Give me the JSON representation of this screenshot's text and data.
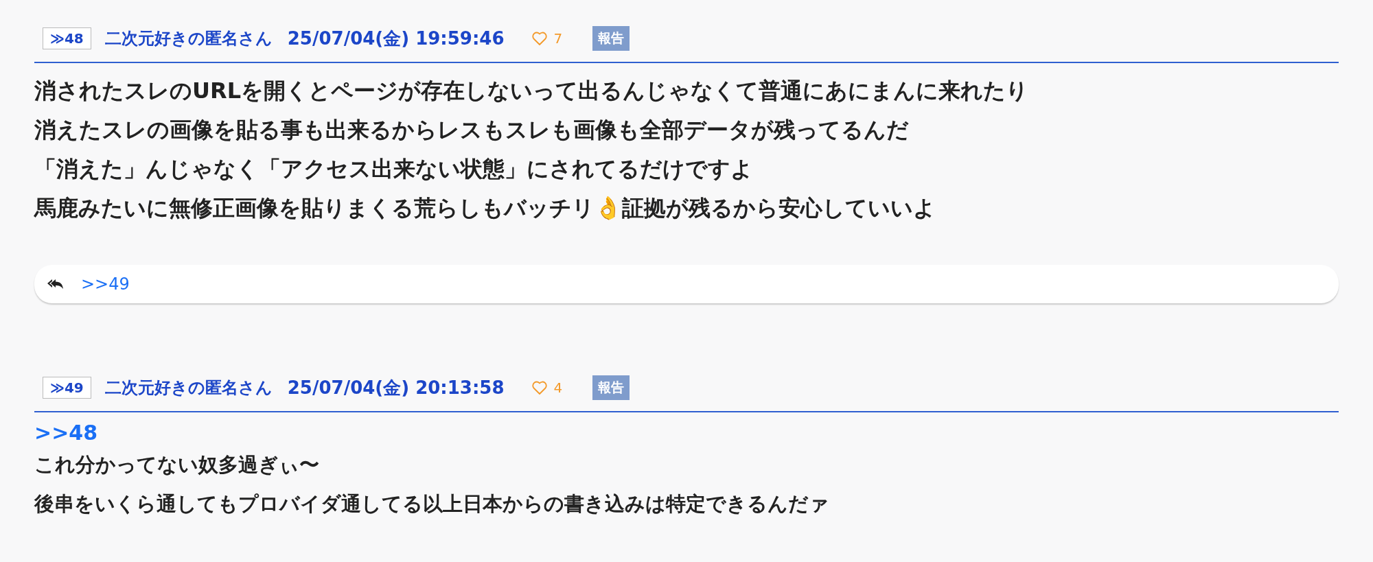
{
  "posts": [
    {
      "number": "≫48",
      "name": "二次元好きの匿名さん",
      "date": "25/07/04(金) 19:59:46",
      "likes": "7",
      "report": "報告",
      "body": [
        {
          "kind": "text",
          "text": "消されたスレのURLを開くとページが存在しないって出るんじゃなくて普通にあにまんに来れたり"
        },
        {
          "kind": "text",
          "text": "消えたスレの画像を貼る事も出来るからレスもスレも画像も全部データが残ってるんだ"
        },
        {
          "kind": "text",
          "text": "「消えた」んじゃなく「アクセス出来ない状態」にされてるだけですよ"
        },
        {
          "kind": "text",
          "text": "馬鹿みたいに無修正画像を貼りまくる荒らしもバッチリ👌証拠が残るから安心していいよ"
        }
      ],
      "replies": [
        ">>49"
      ]
    },
    {
      "number": "≫49",
      "name": "二次元好きの匿名さん",
      "date": "25/07/04(金) 20:13:58",
      "likes": "4",
      "report": "報告",
      "body": [
        {
          "kind": "anchor",
          "text": ">>48"
        },
        {
          "kind": "text",
          "text": "これ分かってない奴多過ぎぃ〜"
        },
        {
          "kind": "text",
          "text": "後串をいくら通してもプロバイダ通してる以上日本からの書き込みは特定できるんだァ"
        }
      ]
    }
  ]
}
